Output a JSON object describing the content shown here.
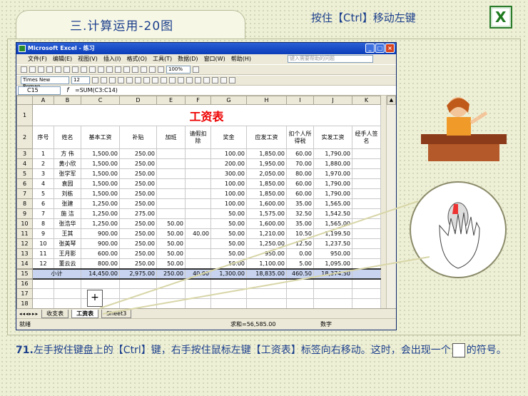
{
  "header": {
    "title": "三.计算运用-20图",
    "hint": "按住【Ctrl】移动左键",
    "excel_logo": "X"
  },
  "excel": {
    "title": "Microsoft Excel - 练习",
    "menu": [
      "文件(F)",
      "编辑(E)",
      "视图(V)",
      "插入(I)",
      "格式(O)",
      "工具(T)",
      "数据(D)",
      "窗口(W)",
      "帮助(H)"
    ],
    "help_placeholder": "键入需要帮助的问题",
    "font": "Times New Roman",
    "font_size": "12",
    "zoom": "100%",
    "name_box": "C15",
    "formula": "=SUM(C3:C14)",
    "columns": [
      "A",
      "B",
      "C",
      "D",
      "E",
      "F",
      "G",
      "H",
      "I",
      "J",
      "K"
    ],
    "sheet_title": "工资表",
    "headers": [
      "序号",
      "姓名",
      "基本工资",
      "补贴",
      "加班",
      "请假扣除",
      "奖金",
      "应发工资",
      "扣个人所得税",
      "实发工资",
      "经手人签名"
    ],
    "rows": [
      [
        "1",
        "方 伟",
        "1,500.00",
        "250.00",
        "",
        "",
        "100.00",
        "1,850.00",
        "60.00",
        "1,790.00",
        ""
      ],
      [
        "2",
        "黄小欣",
        "1,500.00",
        "250.00",
        "",
        "",
        "200.00",
        "1,950.00",
        "70.00",
        "1,880.00",
        ""
      ],
      [
        "3",
        "张学军",
        "1,500.00",
        "250.00",
        "",
        "",
        "300.00",
        "2,050.00",
        "80.00",
        "1,970.00",
        ""
      ],
      [
        "4",
        "袁园",
        "1,500.00",
        "250.00",
        "",
        "",
        "100.00",
        "1,850.00",
        "60.00",
        "1,790.00",
        ""
      ],
      [
        "5",
        "刘栋",
        "1,500.00",
        "250.00",
        "",
        "",
        "100.00",
        "1,850.00",
        "60.00",
        "1,790.00",
        ""
      ],
      [
        "6",
        "张建",
        "1,250.00",
        "250.00",
        "",
        "",
        "100.00",
        "1,600.00",
        "35.00",
        "1,565.00",
        ""
      ],
      [
        "7",
        "施 洁",
        "1,250.00",
        "275.00",
        "",
        "",
        "50.00",
        "1,575.00",
        "32.50",
        "1,542.50",
        ""
      ],
      [
        "8",
        "张浩华",
        "1,250.00",
        "250.00",
        "50.00",
        "",
        "50.00",
        "1,600.00",
        "35.00",
        "1,565.00",
        ""
      ],
      [
        "9",
        "王其",
        "900.00",
        "250.00",
        "50.00",
        "40.00",
        "50.00",
        "1,210.00",
        "10.50",
        "1,199.50",
        ""
      ],
      [
        "10",
        "张美琴",
        "900.00",
        "250.00",
        "50.00",
        "",
        "50.00",
        "1,250.00",
        "12.50",
        "1,237.50",
        ""
      ],
      [
        "11",
        "王月影",
        "600.00",
        "250.00",
        "50.00",
        "",
        "50.00",
        "950.00",
        "0.00",
        "950.00",
        ""
      ],
      [
        "12",
        "董云云",
        "800.00",
        "250.00",
        "50.00",
        "",
        "50.00",
        "1,100.00",
        "5.00",
        "1,095.00",
        ""
      ]
    ],
    "total": [
      "小计",
      "14,450.00",
      "2,975.00",
      "250.00",
      "40.00",
      "1,300.00",
      "18,835.00",
      "460.50",
      "18,374.50"
    ],
    "tabs": [
      "收支表",
      "工资表",
      "Sheet3"
    ],
    "active_tab": "工资表",
    "status_left": "就绪",
    "status_sum": "求和=56,585.00",
    "status_num": "数字"
  },
  "caption": {
    "num": "71.",
    "text1": "左手按住键盘上的【Ctrl】键，右手按住鼠标左键【工资表】标签向右移动。这时，会出现一个",
    "text2": "的符号。"
  }
}
